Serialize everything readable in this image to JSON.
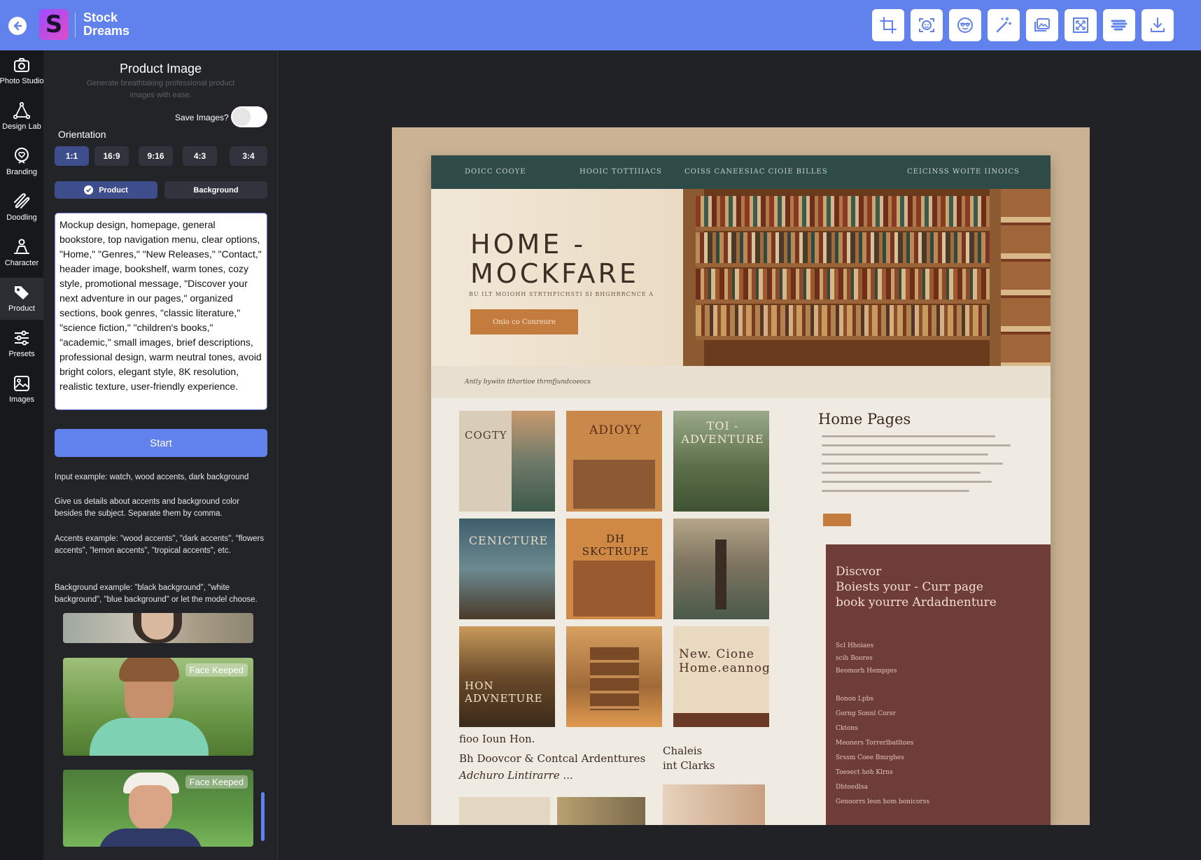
{
  "header": {
    "brand_line1": "Stock",
    "brand_line2": "Dreams",
    "logo_letter": "S",
    "tools": [
      "crop-icon",
      "face-scan-icon",
      "face-swap-icon",
      "magic-wand-icon",
      "gallery-icon",
      "expand-icon",
      "brush-icon",
      "download-icon"
    ]
  },
  "nav": {
    "items": [
      {
        "label": "Photo Studio",
        "icon": "camera-icon"
      },
      {
        "label": "Design Lab",
        "icon": "vector-pen-icon"
      },
      {
        "label": "Branding",
        "icon": "heart-badge-icon"
      },
      {
        "label": "Doodling",
        "icon": "scribble-icon"
      },
      {
        "label": "Character",
        "icon": "person-icon"
      },
      {
        "label": "Product",
        "icon": "tag-icon"
      },
      {
        "label": "Presets",
        "icon": "sliders-icon"
      },
      {
        "label": "Images",
        "icon": "image-icon"
      }
    ],
    "active": "Product"
  },
  "panel": {
    "title": "Product Image",
    "subtitle": "Generate breathtaking professional product images with ease.",
    "save_label": "Save Images?",
    "save_enabled": false,
    "orientation_label": "Orientation",
    "orientations": [
      "1:1",
      "16:9",
      "9:16",
      "4:3",
      "3:4"
    ],
    "orientation_selected": "1:1",
    "modes": [
      "Product",
      "Background"
    ],
    "mode_selected": "Product",
    "prompt": "Mockup design, homepage, general bookstore, top navigation menu, clear options, \"Home,\" \"Genres,\" \"New Releases,\" \"Contact,\" header image, bookshelf, warm tones, cozy style, promotional message, \"Discover your next adventure in our pages,\" organized sections, book genres, \"classic literature,\" \"science fiction,\" \"children's books,\" \"academic,\" small images, brief descriptions, professional design, warm neutral tones, avoid bright colors, elegant style, 8K resolution, realistic texture, user-friendly experience.",
    "start_label": "Start",
    "help": [
      "Input example:  watch, wood accents, dark background",
      "Give us details about accents and background color besides the subject. Separate them by comma.",
      "Accents example: \"wood accents\", \"dark accents\", \"flowers accents\", \"lemon accents\", \"tropical accents\", etc.",
      "Background example:  \"black background\", \"white background\", \"blue background\" or let the model choose."
    ],
    "thumb_badges": [
      "Face Keeped",
      "Face Keeped"
    ]
  },
  "mockup": {
    "nav": [
      "DOICC COOYE",
      "HOOIC TOTTIIIACS",
      "COISS CANEESIAC CIOIE BILLES",
      "CEICINSS WOITE IINOICS"
    ],
    "hero_title": "HOME -\nMOCKFARE",
    "hero_sub": "BU ILT MOIOHH STRTHFICHSTI SI BHGHRRCNCE A",
    "hero_button": "Onio co Conreure",
    "band_text": "Antly bywitn tthortioe thrmfjundcoeocs",
    "books": [
      {
        "title": "COGTY",
        "bg": "#d9cdb9",
        "fg": "#4a3c30"
      },
      {
        "title": "ADIOYY",
        "bg": "#c9894a",
        "fg": "#f4e4c8"
      },
      {
        "title": "TOI - ADVENTURE",
        "bg": "#5d6f4a",
        "fg": "#f1e7d3"
      },
      {
        "title": "CENICTURE",
        "bg": "#3e5e6c",
        "fg": "#eadcc7"
      },
      {
        "title": "DH SKCTRUPE",
        "bg": "#d08944",
        "fg": "#3a2418"
      },
      {
        "title": "",
        "bg": "#7e7460",
        "fg": "#f1e7d3"
      },
      {
        "title": "HON ADVNETURE",
        "bg": "#6a4a2a",
        "fg": "#f4e4c8"
      },
      {
        "title": "",
        "bg": "#a06a38",
        "fg": "#f4e4c8"
      },
      {
        "title": "New. Cione Home.eannoge",
        "bg": "#e8d9c0",
        "fg": "#4b2e22"
      }
    ],
    "right_heading": "Home Pages",
    "promo_title": "Discvor\nBoiests your - Curr page\nbook yourre Ardadnenture",
    "promo_items": [
      "Scl Hhoiaes",
      "scih Boores",
      "Beomorh Hempges",
      "Bonon Lpbs",
      "Gorng Sonnl Corsr",
      "Cktons",
      "Meoners Torrerlbatltoes",
      "Srssm Coee Bmrghes",
      "Toesect hoh Klrns",
      "Dbtoedlsa",
      "Genoorrs leon hom bonicorss"
    ],
    "bottom_left": [
      "fioo Ioun Hon.",
      "Bh Doovcor & Contcal Ardenttures",
      "Adchuro Lintirarre ..."
    ],
    "bottom_right": [
      "Chaleis",
      "int Clarks"
    ]
  }
}
